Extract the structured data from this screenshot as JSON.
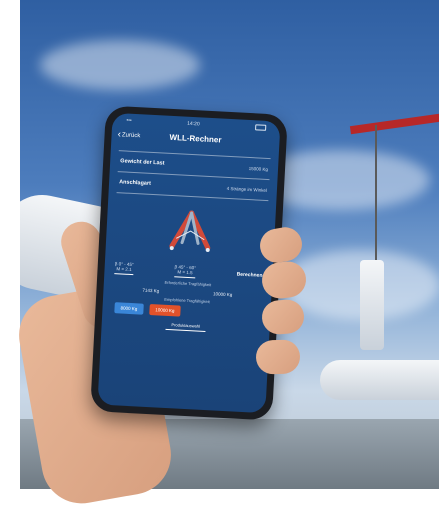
{
  "app": {
    "time": "14:20",
    "back_label": "Zurück",
    "title": "WLL-Rechner"
  },
  "form": {
    "load_label": "Gewicht der Last",
    "load_value": "15000 Kg",
    "sling_label": "Anschlagart",
    "sling_value": "4 Stränge im Winkel"
  },
  "angles": {
    "range1": "β 0° - 45°",
    "m1": "M = 2.1",
    "range2": "β 45° - 60°",
    "m2": "M = 1.5",
    "calc_label": "Berechnen",
    "required_label": "Erforderliche Tragfähigkeit",
    "required1": "7143 Kg",
    "required2": "10000 Kg",
    "suitable_label": "Empfohlene Tragfähigkeit",
    "suitable1": "8000 Kg",
    "suitable2": "10000 Kg",
    "product_tab": "Produktauswahl"
  },
  "colors": {
    "screen_blue": "#1d4e8a",
    "accent_orange": "#e2522a",
    "accent_blue": "#3a86d8",
    "diagram_red": "#d14a3a"
  }
}
